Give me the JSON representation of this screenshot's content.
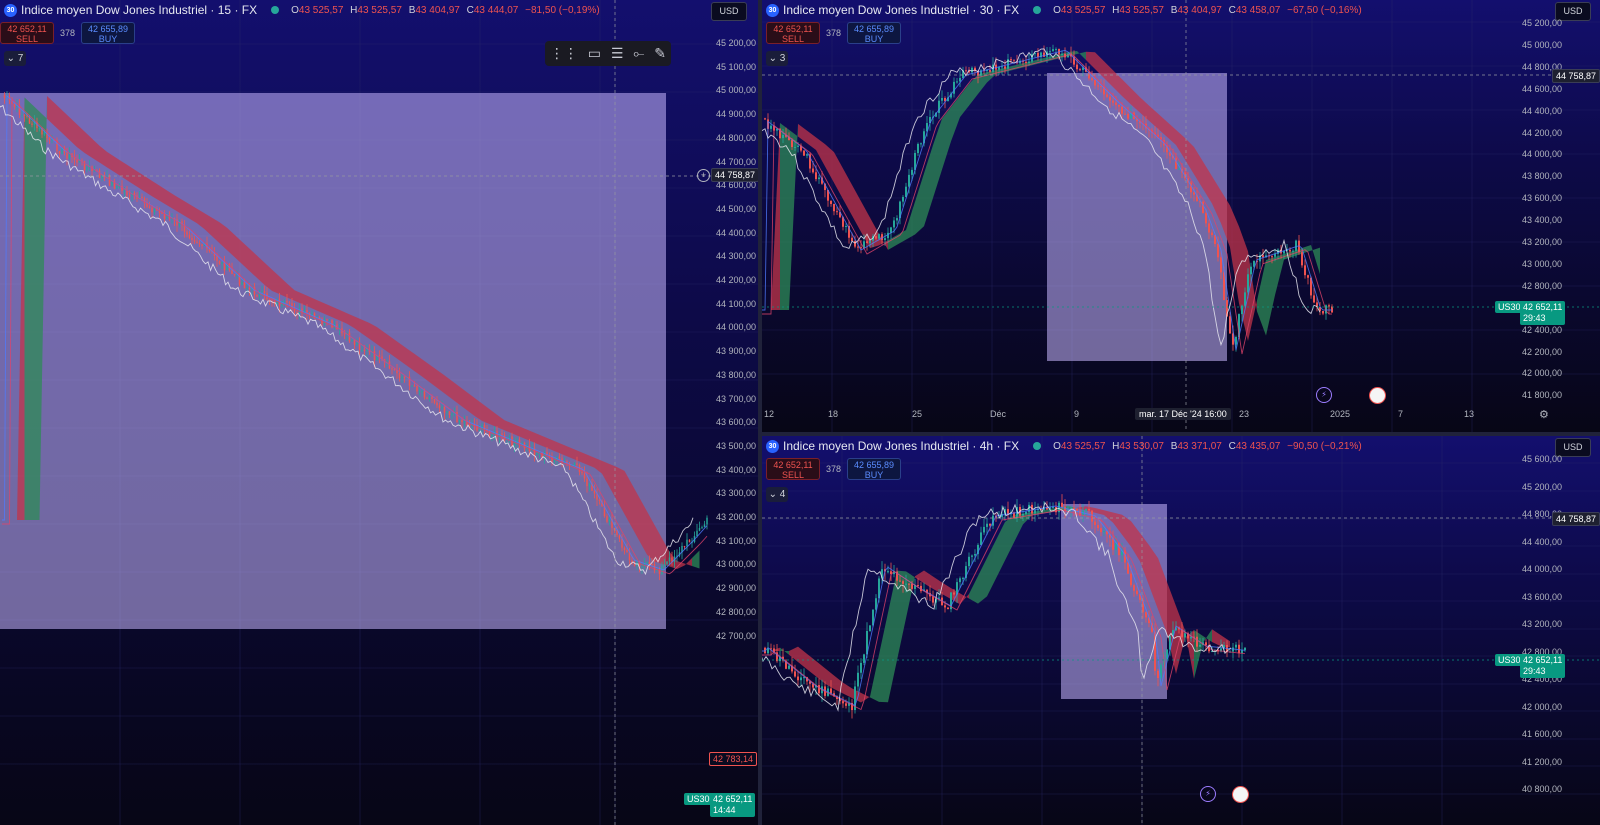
{
  "colors": {
    "up": "#26a69a",
    "down": "#ef5350",
    "cloud_green": "#2e8b57",
    "cloud_red": "#c2344a",
    "box": "#c8b8ff",
    "last_price": "#089981"
  },
  "panes": {
    "left": {
      "title": "Indice moyen Dow Jones Industriel · 15 · FX",
      "ohlc": {
        "o": "43 525,57",
        "h": "43 525,57",
        "b": "43 404,97",
        "c": "43 444,07",
        "chg": "−81,50 (−0,19%)"
      },
      "sell_price": "42 652,11",
      "sell_label": "SELL",
      "spread": "378",
      "buy_price": "42 655,89",
      "buy_label": "BUY",
      "indicator_count": "7",
      "currency": "USD",
      "axis_ticks": [
        "45 200,00",
        "45 100,00",
        "45 000,00",
        "44 900,00",
        "44 800,00",
        "44 700,00",
        "44 600,00",
        "44 500,00",
        "44 400,00",
        "44 300,00",
        "44 200,00",
        "44 100,00",
        "44 000,00",
        "43 900,00",
        "43 800,00",
        "43 700,00",
        "43 600,00",
        "43 500,00",
        "43 400,00",
        "43 300,00",
        "43 200,00",
        "43 100,00",
        "43 000,00",
        "42 900,00",
        "42 800,00",
        "42 700,00"
      ],
      "crosshair_price": "44 758,87",
      "red_price": "42 783,14",
      "last_price": "42 652,11",
      "last_time": "14:44",
      "symbol": "US30"
    },
    "top_right": {
      "title": "Indice moyen Dow Jones Industriel · 30 · FX",
      "ohlc": {
        "o": "43 525,57",
        "h": "43 525,57",
        "b": "43 404,97",
        "c": "43 458,07",
        "chg": "−67,50 (−0,16%)"
      },
      "sell_price": "42 652,11",
      "sell_label": "SELL",
      "spread": "378",
      "buy_price": "42 655,89",
      "buy_label": "BUY",
      "indicator_count": "3",
      "currency": "USD",
      "axis_ticks": [
        "45 200,00",
        "45 000,00",
        "44 800,00",
        "44 600,00",
        "44 400,00",
        "44 200,00",
        "44 000,00",
        "43 800,00",
        "43 600,00",
        "43 400,00",
        "43 200,00",
        "43 000,00",
        "42 800,00",
        "42 600,00",
        "42 400,00",
        "42 200,00",
        "42 000,00",
        "41 800,00"
      ],
      "crosshair_price": "44 758,87",
      "last_price": "42 652,11",
      "last_time": "29:43",
      "symbol": "US30",
      "x_labels": [
        "12",
        "18",
        "25",
        "Déc",
        "9",
        "23",
        "2025",
        "7",
        "13"
      ],
      "crosshair_date": "mar. 17 Déc '24   16:00"
    },
    "bottom_right": {
      "title": "Indice moyen Dow Jones Industriel · 4h · FX",
      "ohlc": {
        "o": "43 525,57",
        "h": "43 530,07",
        "b": "43 371,07",
        "c": "43 435,07",
        "chg": "−90,50 (−0,21%)"
      },
      "sell_price": "42 652,11",
      "sell_label": "SELL",
      "spread": "378",
      "buy_price": "42 655,89",
      "buy_label": "BUY",
      "indicator_count": "4",
      "currency": "USD",
      "axis_ticks": [
        "45 600,00",
        "45 200,00",
        "44 800,00",
        "44 400,00",
        "44 000,00",
        "43 600,00",
        "43 200,00",
        "42 800,00",
        "42 400,00",
        "42 000,00",
        "41 600,00",
        "41 200,00",
        "40 800,00"
      ],
      "crosshair_price": "44 758,87",
      "last_price": "42 652,11",
      "last_time": "29:43",
      "symbol": "US30"
    }
  },
  "toolbar": {
    "icons": [
      "drag-handle-icon",
      "rectangle-tool-icon",
      "settings-lines-icon",
      "line-tool-icon",
      "brush-tool-icon"
    ]
  }
}
